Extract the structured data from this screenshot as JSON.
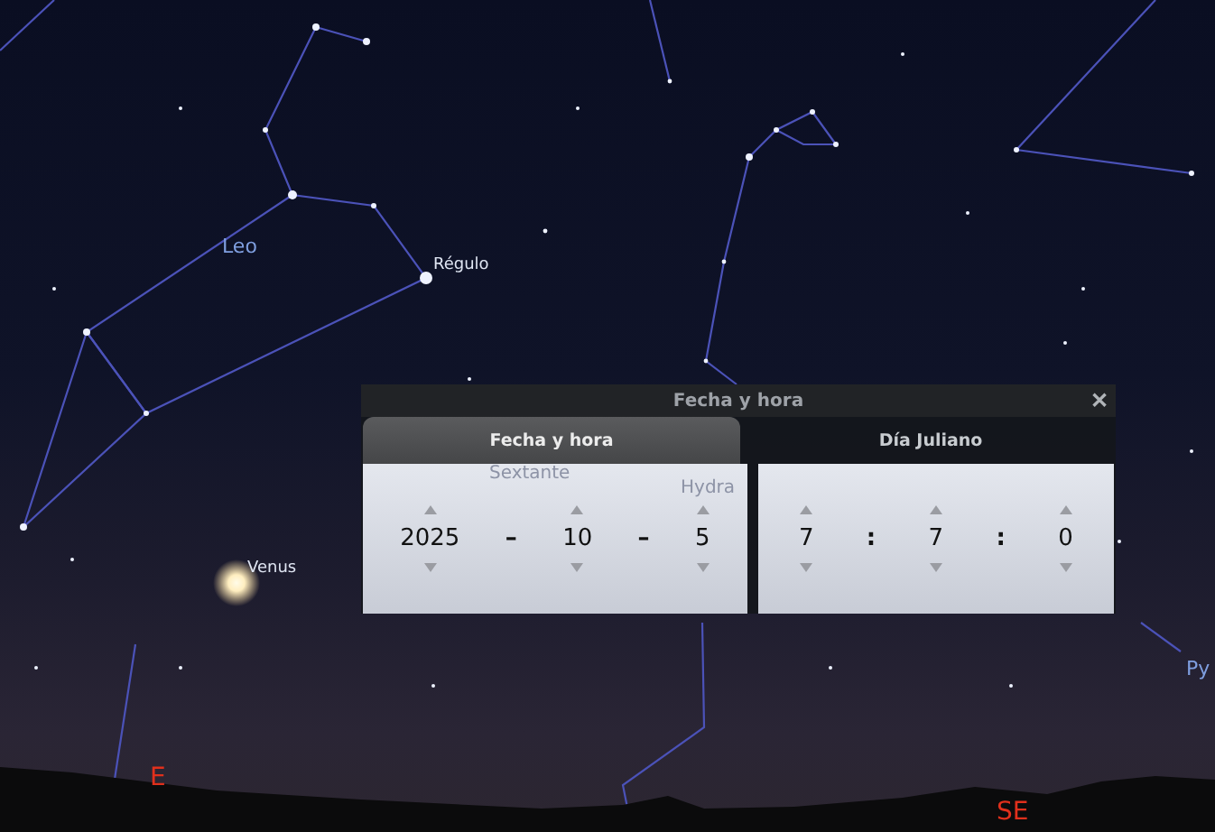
{
  "sky_labels": [
    {
      "kind": "constellation",
      "text": "Leo"
    },
    {
      "kind": "star",
      "text": "Régulo"
    },
    {
      "kind": "planet",
      "text": "Venus"
    },
    {
      "kind": "constellation",
      "text": "Py"
    },
    {
      "kind": "cardinal",
      "text": "E"
    },
    {
      "kind": "cardinal",
      "text": "SE"
    }
  ],
  "dialog": {
    "title": "Fecha y hora",
    "close": "✕",
    "tabs": [
      {
        "label": "Fecha y hora",
        "selected": true
      },
      {
        "label": "Día Juliano",
        "selected": false
      }
    ],
    "faint_labels": [
      {
        "text": "Sextante"
      },
      {
        "text": "Hydra"
      }
    ],
    "date_parts": [
      {
        "kind": "field",
        "value": "2025"
      },
      {
        "kind": "separator",
        "value": "–"
      },
      {
        "kind": "field",
        "value": "10"
      },
      {
        "kind": "separator",
        "value": "–"
      },
      {
        "kind": "field",
        "value": "5"
      }
    ],
    "time_parts": [
      {
        "kind": "field",
        "value": "7"
      },
      {
        "kind": "separator",
        "value": ":"
      },
      {
        "kind": "field",
        "value": "7"
      },
      {
        "kind": "separator",
        "value": ":"
      },
      {
        "kind": "field",
        "value": "0"
      }
    ]
  }
}
